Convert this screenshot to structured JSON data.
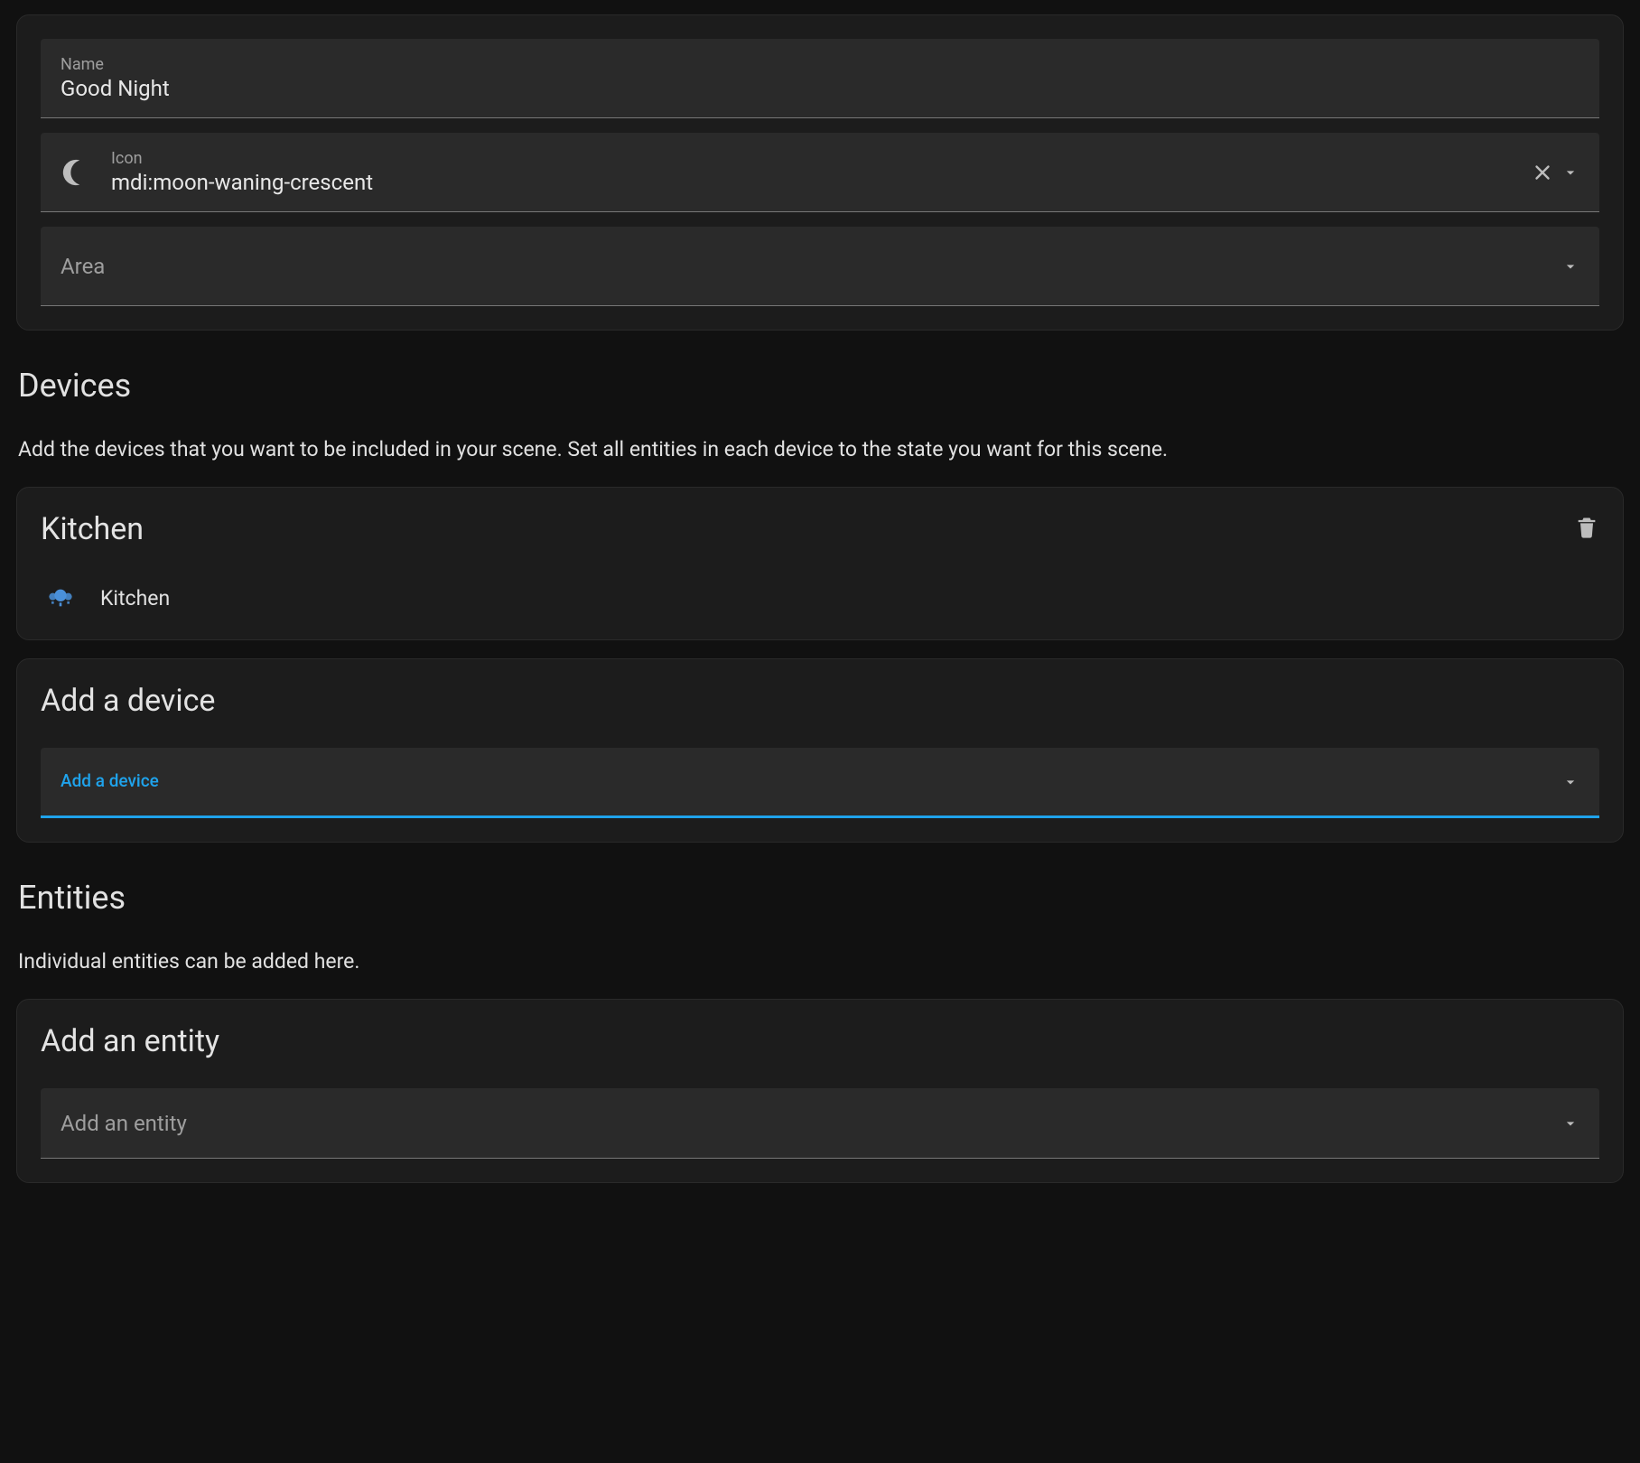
{
  "config": {
    "name_label": "Name",
    "name_value": "Good Night",
    "icon_label": "Icon",
    "icon_value": "mdi:moon-waning-crescent",
    "area_label": "Area",
    "area_value": ""
  },
  "devices": {
    "heading": "Devices",
    "description": "Add the devices that you want to be included in your scene. Set all entities in each device to the state you want for this scene.",
    "items": [
      {
        "title": "Kitchen",
        "entity_name": "Kitchen"
      }
    ],
    "add_card_title": "Add a device",
    "add_field_label": "Add a device"
  },
  "entities": {
    "heading": "Entities",
    "description": "Individual entities can be added here.",
    "add_card_title": "Add an entity",
    "add_field_placeholder": "Add an entity"
  }
}
